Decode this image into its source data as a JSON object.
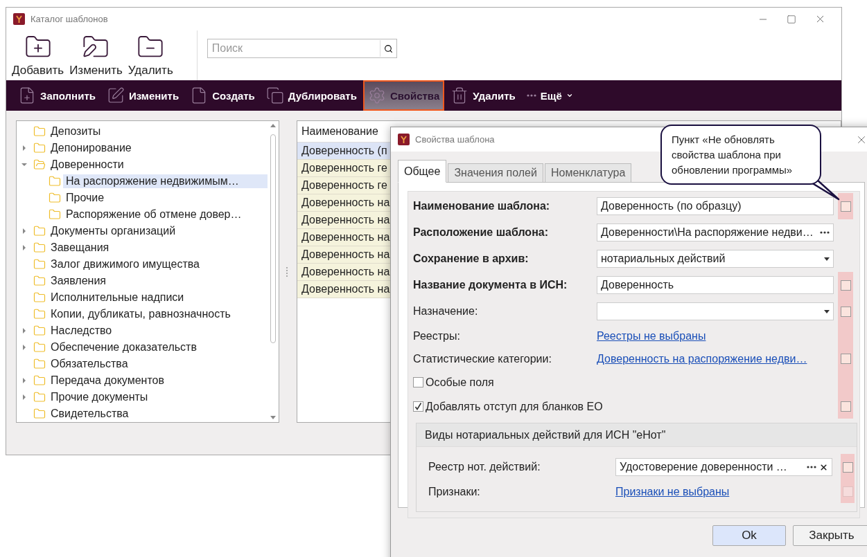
{
  "main_window": {
    "title": "Каталог шаблонов"
  },
  "ribbon": [
    {
      "label": "Добавить",
      "kind": "add"
    },
    {
      "label": "Изменить",
      "kind": "edit"
    },
    {
      "label": "Удалить",
      "kind": "remove"
    }
  ],
  "search": {
    "placeholder": "Поиск"
  },
  "toolbar": [
    {
      "label": "Заполнить",
      "kind": "fill",
      "highlighted": false
    },
    {
      "label": "Изменить",
      "kind": "edit",
      "highlighted": false
    },
    {
      "label": "Создать",
      "kind": "create",
      "highlighted": false
    },
    {
      "label": "Дублировать",
      "kind": "duplicate",
      "highlighted": false
    },
    {
      "label": "Свойства",
      "kind": "properties",
      "highlighted": true
    },
    {
      "label": "Удалить",
      "kind": "delete",
      "highlighted": false
    },
    {
      "label": "Ещё",
      "kind": "more",
      "highlighted": false
    }
  ],
  "tree": [
    {
      "label": "Депозиты",
      "kind": "leaf",
      "selected": false
    },
    {
      "label": "Депонирование",
      "kind": "group",
      "expanded": false,
      "selected": false
    },
    {
      "label": "Доверенности",
      "kind": "group",
      "expanded": true,
      "selected": false,
      "children": [
        {
          "label": "На распоряжение недвижимым…",
          "kind": "leaf",
          "selected": true
        },
        {
          "label": "Прочие",
          "kind": "leaf",
          "selected": false
        },
        {
          "label": "Распоряжение об отмене довер…",
          "kind": "leaf",
          "selected": false
        }
      ]
    },
    {
      "label": "Документы организаций",
      "kind": "group",
      "expanded": false,
      "selected": false
    },
    {
      "label": "Завещания",
      "kind": "group",
      "expanded": false,
      "selected": false
    },
    {
      "label": "Залог движимого имущества",
      "kind": "leaf",
      "selected": false
    },
    {
      "label": "Заявления",
      "kind": "leaf",
      "selected": false
    },
    {
      "label": "Исполнительные надписи",
      "kind": "leaf",
      "selected": false
    },
    {
      "label": "Копии, дубликаты, равнозначность",
      "kind": "leaf",
      "selected": false
    },
    {
      "label": "Наследство",
      "kind": "group",
      "expanded": false,
      "selected": false
    },
    {
      "label": "Обеспечение доказательств",
      "kind": "group",
      "expanded": false,
      "selected": false
    },
    {
      "label": "Обязательства",
      "kind": "leaf",
      "selected": false
    },
    {
      "label": "Передача документов",
      "kind": "group",
      "expanded": false,
      "selected": false
    },
    {
      "label": "Прочие документы",
      "kind": "group",
      "expanded": false,
      "selected": false
    },
    {
      "label": "Свидетельства",
      "kind": "leaf",
      "selected": false
    }
  ],
  "grid": {
    "columns": [
      "Наименование"
    ],
    "rows": [
      {
        "cells": [
          "Доверенность (п"
        ],
        "selected": true
      },
      {
        "cells": [
          "Доверенность ге"
        ],
        "selected": false
      },
      {
        "cells": [
          "Доверенность ге"
        ],
        "selected": false
      },
      {
        "cells": [
          "Доверенность на"
        ],
        "selected": false
      },
      {
        "cells": [
          "Доверенность на"
        ],
        "selected": false
      },
      {
        "cells": [
          "Доверенность на"
        ],
        "selected": false
      },
      {
        "cells": [
          "Доверенность на"
        ],
        "selected": false
      },
      {
        "cells": [
          "Доверенность на"
        ],
        "selected": false
      },
      {
        "cells": [
          "Доверенность на"
        ],
        "selected": false
      }
    ]
  },
  "dialog": {
    "title": "Свойства шаблона",
    "tabs": [
      {
        "label": "Общее",
        "selected": true
      },
      {
        "label": "Значения полей",
        "selected": false
      },
      {
        "label": "Номенклатура",
        "selected": false
      }
    ],
    "fields": [
      {
        "kind": "text",
        "label": "Наименование шаблона:",
        "bold": true,
        "value": "Доверенность (по образцу)",
        "highlighted": true,
        "lock": {
          "checked": false,
          "disabled": false
        }
      },
      {
        "kind": "browse",
        "label": "Расположение  шаблона:",
        "bold": true,
        "value": "Доверенности\\На распоряжение недви…",
        "highlighted": false
      },
      {
        "kind": "select",
        "label": "Сохранение в архив:",
        "bold": true,
        "value": "нотариальных действий",
        "highlighted": false
      },
      {
        "kind": "text",
        "label": "Название документа в ИСН:",
        "bold": true,
        "value": "Доверенность",
        "highlighted": true,
        "lock": {
          "checked": false,
          "disabled": false
        }
      },
      {
        "kind": "select",
        "label": "Назначение:",
        "bold": false,
        "highlighted": true,
        "lock": {
          "checked": false,
          "disabled": false
        }
      },
      {
        "kind": "link",
        "label": "Реестры:",
        "bold": false,
        "value": "Реестры не выбраны",
        "highlighted": true
      },
      {
        "kind": "link",
        "label": "Статистические категории:",
        "bold": false,
        "value": "Доверенность на распоряжение недви…",
        "highlighted": true,
        "lock": {
          "checked": false,
          "disabled": false
        }
      },
      {
        "kind": "check",
        "label": "Особые поля",
        "checked": false,
        "highlighted": true
      },
      {
        "kind": "check",
        "label": "Добавлять отступ для бланков ЕО",
        "checked": true,
        "highlighted": true,
        "lock": {
          "checked": false,
          "disabled": false
        }
      }
    ],
    "group": {
      "title": "Виды нотариальных действий для ИСН \"еНот\"",
      "fields": [
        {
          "kind": "picker",
          "label": "Реестр нот. действий:",
          "bold": false,
          "value": "Удостоверение доверенности …",
          "highlighted": true,
          "lock": {
            "checked": false,
            "disabled": false
          }
        },
        {
          "kind": "link",
          "label": "Признаки:",
          "bold": false,
          "value": "Признаки не выбраны",
          "highlighted": true,
          "lock": {
            "checked": false,
            "disabled": true
          }
        }
      ]
    },
    "buttons": [
      {
        "label": "Ok",
        "default": true
      },
      {
        "label": "Закрыть",
        "default": false
      }
    ]
  },
  "callout": {
    "text": "Пункт «Не обновлять свойства шаблона при обновлении программы»"
  }
}
